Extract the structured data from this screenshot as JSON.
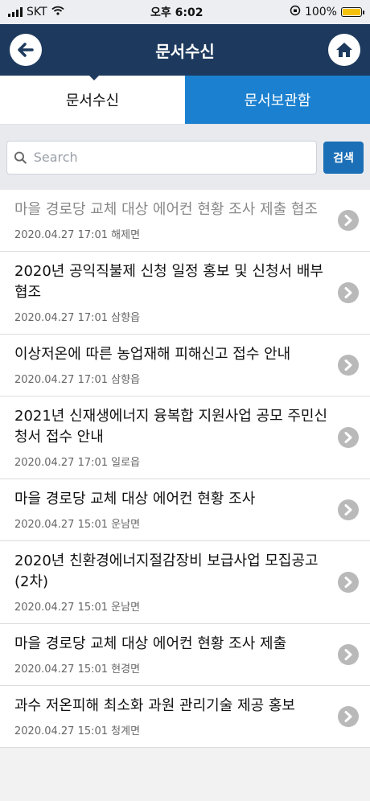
{
  "status": {
    "carrier": "SKT",
    "time": "오후 6:02",
    "battery": "100%",
    "battery_level": 1.0
  },
  "header": {
    "title": "문서수신",
    "back_icon": "back-arrow-icon",
    "home_icon": "home-icon"
  },
  "tabs": [
    {
      "label": "문서수신",
      "active": true
    },
    {
      "label": "문서보관함",
      "active": false
    }
  ],
  "search": {
    "placeholder": "Search",
    "value": "",
    "button_label": "검색"
  },
  "items": [
    {
      "title": "마을 경로당 교체 대상 에어컨 현황 조사 제출 협조",
      "date": "2020.04.27 17:01",
      "dept": "해제면",
      "read": true
    },
    {
      "title": "2020년 공익직불제 신청 일정 홍보 및 신청서 배부 협조",
      "date": "2020.04.27 17:01",
      "dept": "삼향읍",
      "read": false
    },
    {
      "title": "이상저온에 따른 농업재해 피해신고 접수 안내",
      "date": "2020.04.27 17:01",
      "dept": "삼향읍",
      "read": false
    },
    {
      "title": "2021년 신재생에너지 융복합 지원사업 공모 주민신청서 접수 안내",
      "date": "2020.04.27 17:01",
      "dept": "일로읍",
      "read": false
    },
    {
      "title": "마을 경로당 교체 대상 에어컨 현황 조사",
      "date": "2020.04.27 15:01",
      "dept": "운남면",
      "read": false
    },
    {
      "title": "2020년 친환경에너지절감장비 보급사업 모집공고 (2차)",
      "date": "2020.04.27 15:01",
      "dept": "운남면",
      "read": false
    },
    {
      "title": "마을 경로당 교체 대상 에어컨 현황 조사 제출",
      "date": "2020.04.27 15:01",
      "dept": "현경면",
      "read": false
    },
    {
      "title": "과수 저온피해 최소화 과원 관리기술 제공 홍보",
      "date": "2020.04.27 15:01",
      "dept": "청계면",
      "read": false
    }
  ],
  "colors": {
    "header": "#1d3a5e",
    "tab_inactive": "#1b80cf",
    "search_button": "#1b6fb6",
    "chevron": "#b9b9b9"
  }
}
